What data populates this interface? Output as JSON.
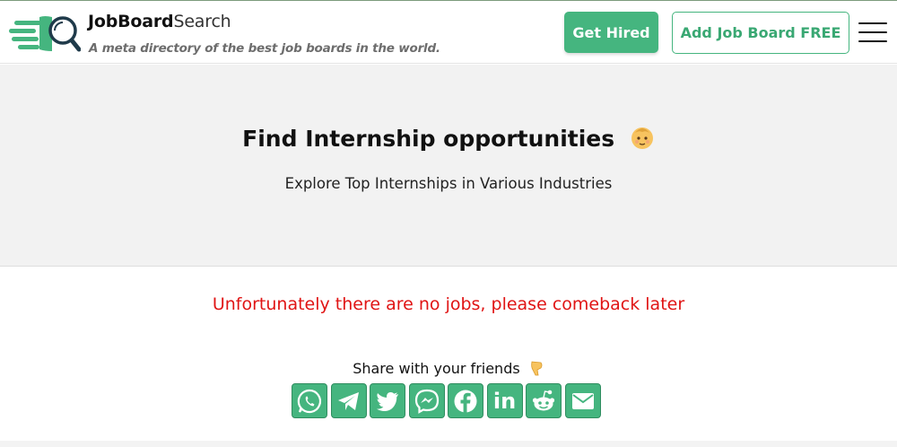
{
  "brand": {
    "name_bold": "JobBoard",
    "name_light": "Search",
    "tagline": "A meta directory of the best job boards in the world.",
    "colors": {
      "primary": "#45b57f",
      "logo_dark": "#1f3a4a"
    }
  },
  "nav": {
    "get_hired_label": "Get Hired",
    "add_board_label": "Add Job Board FREE",
    "menu_icon": "hamburger-menu-icon"
  },
  "hero": {
    "title": "Find Internship opportunities",
    "title_emoji": "baby-emoji",
    "subtitle": "Explore Top Internships in Various Industries"
  },
  "content": {
    "empty_message": "Unfortunately there are no jobs, please comeback later",
    "empty_color": "#e01414"
  },
  "share": {
    "label": "Share with your friends",
    "label_emoji": "pointing-down-emoji",
    "buttons": [
      {
        "network": "WhatsApp",
        "icon": "whatsapp-icon"
      },
      {
        "network": "Telegram",
        "icon": "telegram-icon"
      },
      {
        "network": "Twitter",
        "icon": "twitter-icon"
      },
      {
        "network": "Messenger",
        "icon": "messenger-icon"
      },
      {
        "network": "Facebook",
        "icon": "facebook-icon"
      },
      {
        "network": "LinkedIn",
        "icon": "linkedin-icon"
      },
      {
        "network": "Reddit",
        "icon": "reddit-icon"
      },
      {
        "network": "Email",
        "icon": "email-icon"
      }
    ]
  }
}
